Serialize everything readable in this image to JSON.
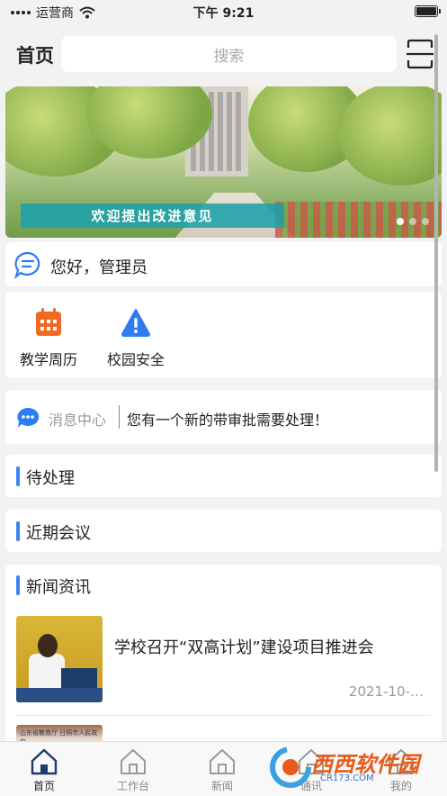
{
  "status_bar": {
    "carrier": "运营商",
    "time": "下午 9:21"
  },
  "header": {
    "title": "首页",
    "search_placeholder": "搜索"
  },
  "banner": {
    "caption": "欢迎提出改进意见",
    "dot_count": 3,
    "active_dot": 0
  },
  "greeting": {
    "text": "您好，管理员"
  },
  "apps": [
    {
      "label": "教学周历",
      "icon": "calendar-icon",
      "color": "#f26a21"
    },
    {
      "label": "校园安全",
      "icon": "warning-icon",
      "color": "#2f7bf0"
    }
  ],
  "message_center": {
    "name": "消息中心",
    "text": "您有一个新的带审批需要处理！"
  },
  "sections": {
    "todo": "待处理",
    "meetings": "近期会议"
  },
  "news": {
    "title": "新闻资讯",
    "items": [
      {
        "headline": "学校召开“双高计划”建设项目推进会",
        "date": "2021-10-…"
      }
    ],
    "thumb2_text": "山东省教育厅 日照市人民政府"
  },
  "tabs": [
    {
      "label": "首页",
      "active": true
    },
    {
      "label": "工作台",
      "active": false
    },
    {
      "label": "新闻",
      "active": false
    },
    {
      "label": "通讯",
      "active": false
    },
    {
      "label": "我的",
      "active": false
    }
  ],
  "watermark": {
    "text": "西西软件园",
    "sub": "CR173.COM"
  },
  "colors": {
    "accent": "#3c82f0",
    "calendar": "#f26a21",
    "warning": "#2f7bf0",
    "banner_caption": "#1ea0aa"
  }
}
